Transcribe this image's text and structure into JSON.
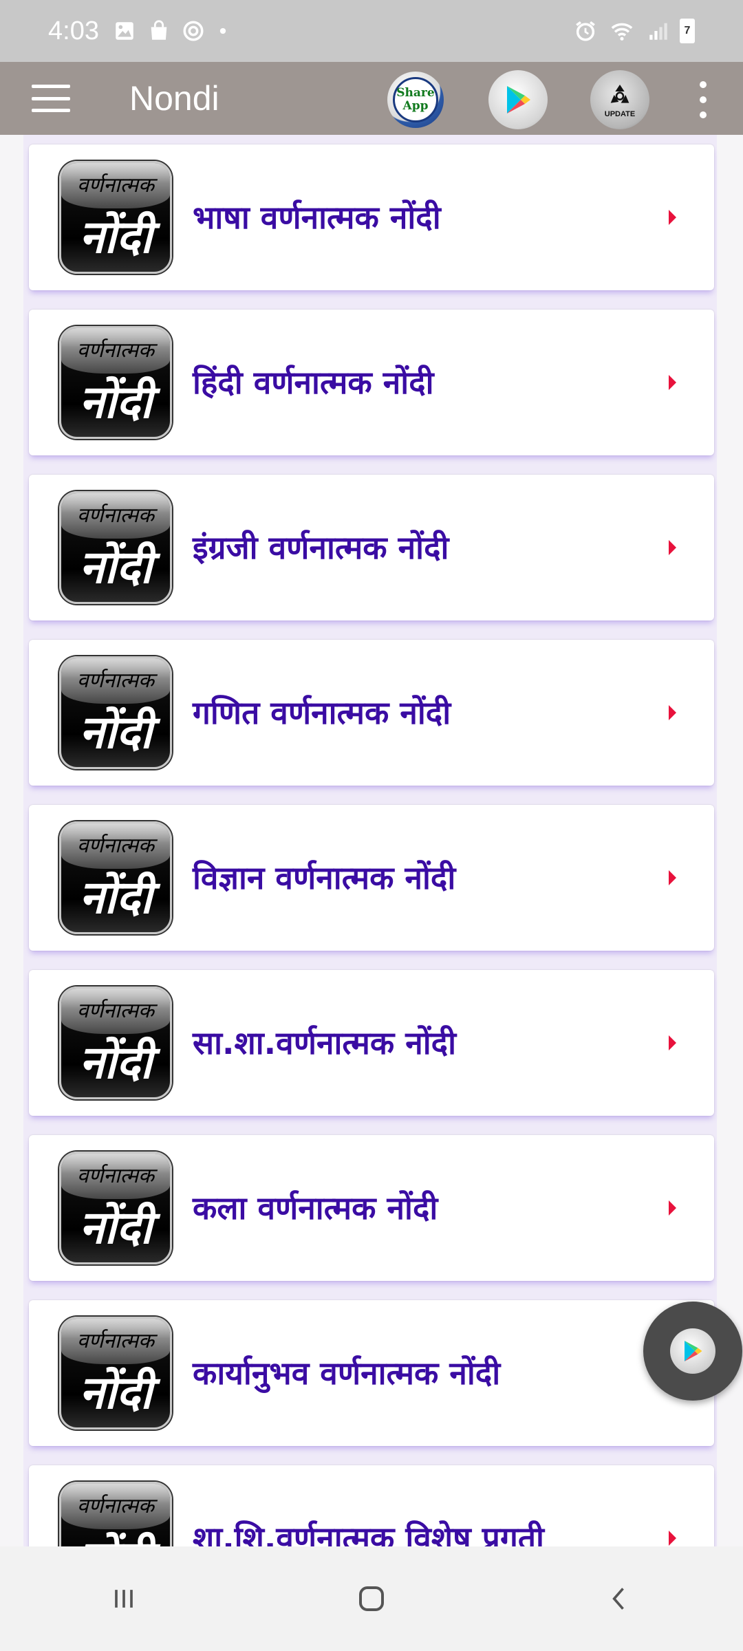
{
  "status_bar": {
    "time": "4:03",
    "icons_left": [
      "gallery-icon",
      "shopping-bag-icon",
      "sync-icon",
      "dot-icon"
    ],
    "icons_right": [
      "alarm-icon",
      "wifi-icon",
      "signal-icon",
      "battery-icon"
    ],
    "battery_level": "7"
  },
  "app_bar": {
    "title": "Nondi",
    "share_label_line1": "Share",
    "share_label_line2": "App",
    "update_label": "UPDATE"
  },
  "list": {
    "icon_top_text": "वर्णनात्मक",
    "icon_main_text": "नोंदी",
    "items": [
      {
        "label": "भाषा वर्णनात्मक नोंदी"
      },
      {
        "label": "हिंदी वर्णनात्मक नोंदी"
      },
      {
        "label": "इंग्रजी वर्णनात्मक नोंदी"
      },
      {
        "label": "गणित वर्णनात्मक नोंदी"
      },
      {
        "label": "विज्ञान वर्णनात्मक नोंदी"
      },
      {
        "label": "सा.शा.वर्णनात्मक नोंदी"
      },
      {
        "label": "कला वर्णनात्मक नोंदी"
      },
      {
        "label": "कार्यानुभव वर्णनात्मक नोंदी"
      },
      {
        "label": "शा.शि.वर्णनात्मक विशेष प्रगती"
      }
    ]
  },
  "colors": {
    "app_bar": "#9e9692",
    "label_text": "#3a0ca3",
    "arrow": "#e8123c",
    "fab": "#4b4b4b"
  }
}
